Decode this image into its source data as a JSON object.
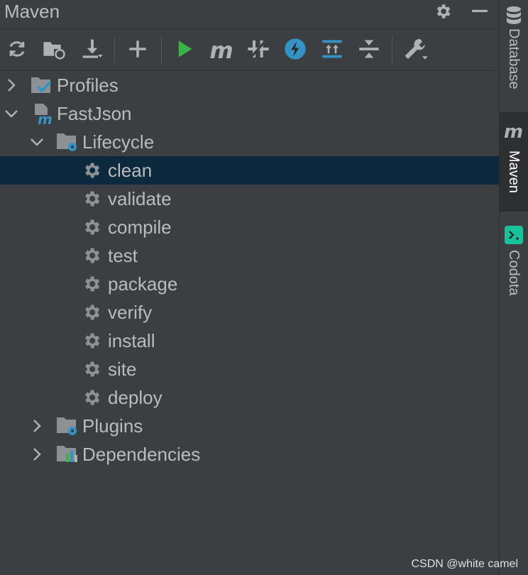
{
  "panel": {
    "title": "Maven",
    "settings_icon": "gear-icon",
    "minimize_icon": "minimize-icon"
  },
  "toolbar": {
    "buttons": [
      {
        "name": "reload-all-projects-button",
        "icon": "reload-icon"
      },
      {
        "name": "generate-sources-button",
        "icon": "folder-reload-icon"
      },
      {
        "name": "download-sources-button",
        "icon": "download-icon"
      },
      {
        "name": "add-maven-project-button",
        "icon": "plus-icon"
      },
      {
        "name": "run-maven-build-button",
        "icon": "run-icon"
      },
      {
        "name": "execute-maven-goal-button",
        "icon": "maven-m-icon"
      },
      {
        "name": "toggle-offline-mode-button",
        "icon": "offline-icon"
      },
      {
        "name": "skip-tests-button",
        "icon": "lightning-icon"
      },
      {
        "name": "show-dependencies-button",
        "icon": "dependencies-icon"
      },
      {
        "name": "collapse-all-button",
        "icon": "collapse-icon"
      },
      {
        "name": "maven-settings-button",
        "icon": "wrench-icon"
      }
    ]
  },
  "tree": {
    "profiles": "Profiles",
    "project": "FastJson",
    "lifecycle": "Lifecycle",
    "goals": [
      "clean",
      "validate",
      "compile",
      "test",
      "package",
      "verify",
      "install",
      "site",
      "deploy"
    ],
    "selected_goal": "clean",
    "plugins": "Plugins",
    "dependencies": "Dependencies"
  },
  "right_tabs": [
    {
      "label": "Database",
      "icon": "database-icon"
    },
    {
      "label": "Maven",
      "icon": "maven-m-icon",
      "active": true
    },
    {
      "label": "Codota",
      "icon": "codota-icon"
    }
  ],
  "watermark": "CSDN @white camel",
  "colors": {
    "background": "#3c3f41",
    "selection": "#0d293e",
    "run_green": "#3cb34a",
    "accent_blue": "#3592c4",
    "codota_green": "#18c39c"
  }
}
